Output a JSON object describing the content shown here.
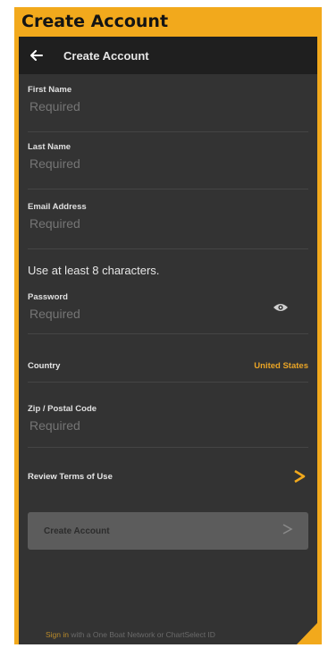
{
  "tag": {
    "label": "Create Account"
  },
  "header": {
    "title": "Create Account",
    "back_icon": "back-arrow-icon"
  },
  "form": {
    "first_name": {
      "label": "First Name",
      "placeholder": "Required"
    },
    "last_name": {
      "label": "Last Name",
      "placeholder": "Required"
    },
    "email": {
      "label": "Email Address",
      "placeholder": "Required"
    },
    "password_hint": "Use at least 8 characters.",
    "password": {
      "label": "Password",
      "placeholder": "Required",
      "toggle_icon": "eye-icon"
    },
    "country": {
      "label": "Country",
      "value": "United States"
    },
    "zip": {
      "label": "Zip / Postal Code",
      "placeholder": "Required"
    },
    "terms": {
      "label": "Review Terms of Use",
      "icon": "chevron-right-icon"
    }
  },
  "create_button": {
    "label": "Create Account",
    "icon": "chevron-right-icon"
  },
  "footer": {
    "signin_link": "Sign in",
    "text": " with a One Boat Network or ChartSelect ID"
  },
  "colors": {
    "accent": "#f2a91c",
    "background": "#333333",
    "topbar": "#1f1f1f",
    "value_text": "#e9a426"
  }
}
